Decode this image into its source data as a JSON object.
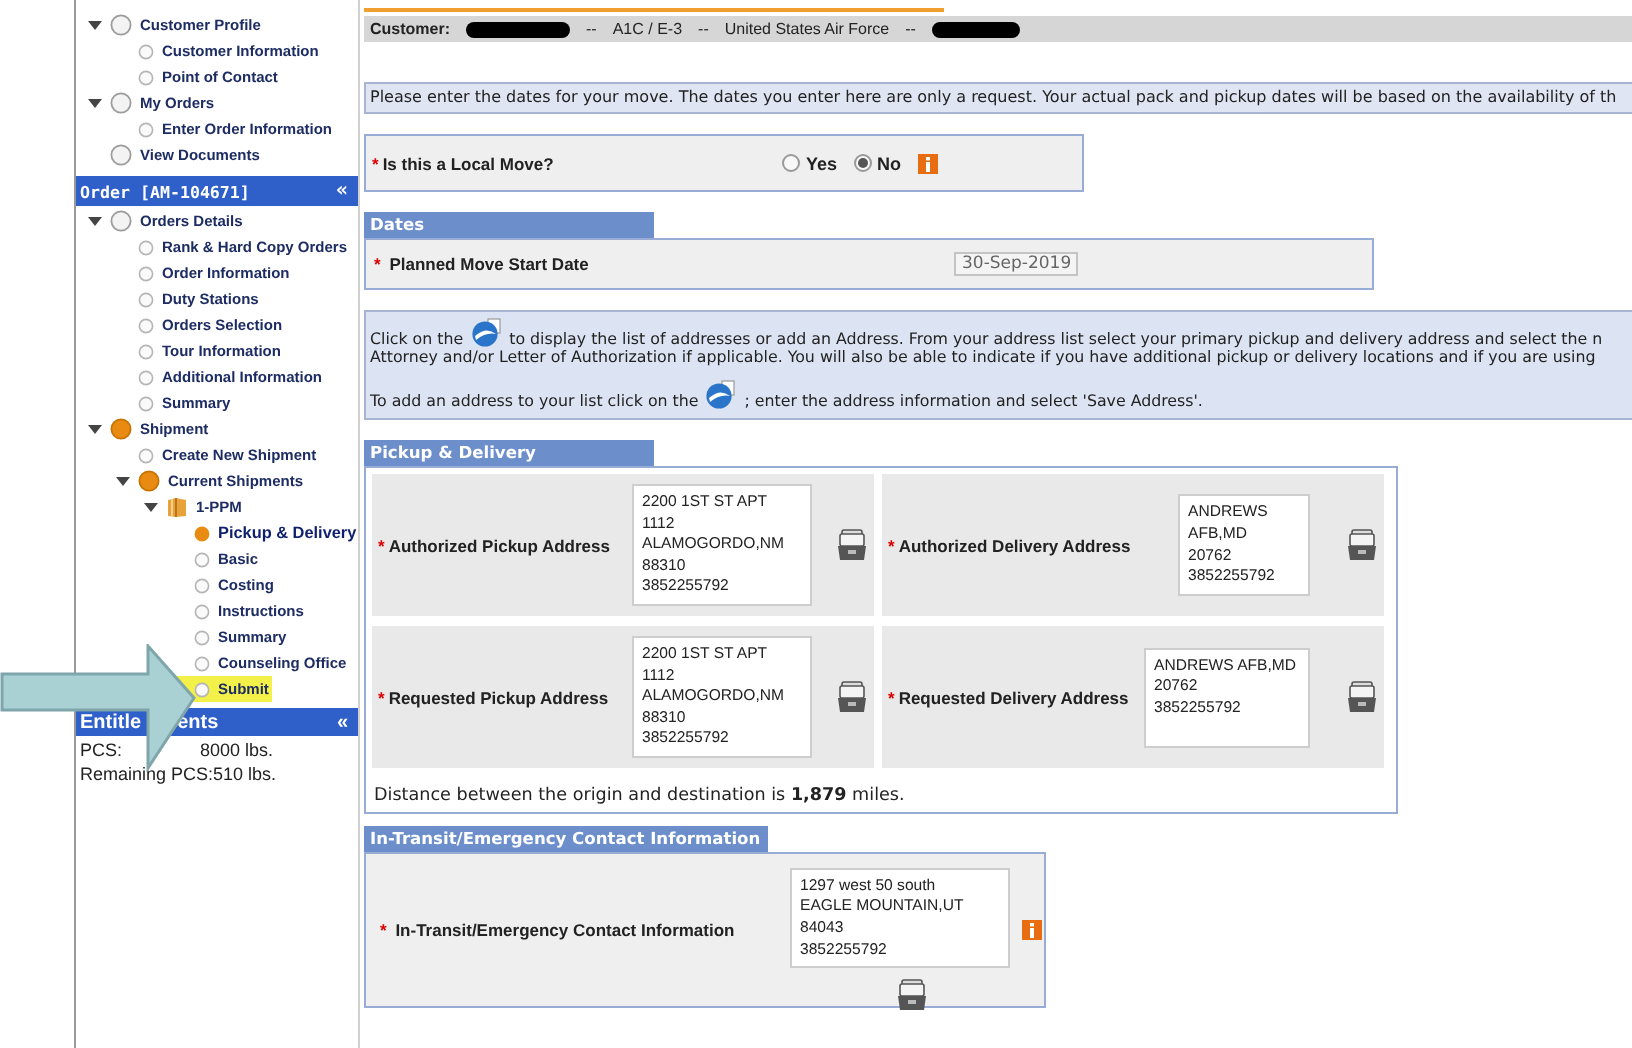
{
  "sidebar": {
    "tree": [
      {
        "label": "Customer Profile",
        "kind": "group",
        "active": false,
        "selected": false,
        "highlighted": false,
        "expanded": true,
        "children": [
          {
            "label": "Customer Information",
            "kind": "page",
            "active": false,
            "selected": false,
            "highlighted": false
          },
          {
            "label": "Point of Contact",
            "kind": "page",
            "active": false,
            "selected": false,
            "highlighted": false
          }
        ]
      },
      {
        "label": "My Orders",
        "kind": "group",
        "active": false,
        "selected": false,
        "highlighted": false,
        "expanded": true,
        "children": [
          {
            "label": "Enter Order Information",
            "kind": "page",
            "active": false,
            "selected": false,
            "highlighted": false
          }
        ]
      },
      {
        "label": "View Documents",
        "kind": "group",
        "active": false,
        "selected": false,
        "highlighted": false
      }
    ],
    "order_panel": {
      "title": "Order [AM-104671]",
      "collapse": "«",
      "tree": [
        {
          "label": "Orders Details",
          "kind": "group",
          "active": false,
          "selected": false,
          "highlighted": false,
          "expanded": true,
          "children": [
            {
              "label": "Rank & Hard Copy Orders",
              "kind": "page",
              "active": false,
              "selected": false,
              "highlighted": false
            },
            {
              "label": "Order Information",
              "kind": "page",
              "active": false,
              "selected": false,
              "highlighted": false
            },
            {
              "label": "Duty Stations",
              "kind": "page",
              "active": false,
              "selected": false,
              "highlighted": false
            },
            {
              "label": "Orders Selection",
              "kind": "page",
              "active": false,
              "selected": false,
              "highlighted": false
            },
            {
              "label": "Tour Information",
              "kind": "page",
              "active": false,
              "selected": false,
              "highlighted": false
            },
            {
              "label": "Additional Information",
              "kind": "page",
              "active": false,
              "selected": false,
              "highlighted": false
            },
            {
              "label": "Summary",
              "kind": "page",
              "active": false,
              "selected": false,
              "highlighted": false
            }
          ]
        },
        {
          "label": "Shipment",
          "kind": "group",
          "active": true,
          "selected": false,
          "highlighted": false,
          "expanded": true,
          "children": [
            {
              "label": "Create New Shipment",
              "kind": "page",
              "active": false,
              "selected": false,
              "highlighted": false
            },
            {
              "label": "Current Shipments",
              "kind": "group",
              "active": true,
              "selected": false,
              "highlighted": false,
              "expanded": true,
              "children": [
                {
                  "label": "1-PPM",
                  "kind": "shipment",
                  "active": true,
                  "selected": false,
                  "highlighted": false,
                  "expanded": true,
                  "children": [
                    {
                      "label": "Pickup & Delivery",
                      "kind": "page",
                      "active": true,
                      "selected": true,
                      "highlighted": false
                    },
                    {
                      "label": "Basic",
                      "kind": "page",
                      "active": false,
                      "selected": false,
                      "highlighted": false
                    },
                    {
                      "label": "Costing",
                      "kind": "page",
                      "active": false,
                      "selected": false,
                      "highlighted": false
                    },
                    {
                      "label": "Instructions",
                      "kind": "page",
                      "active": false,
                      "selected": false,
                      "highlighted": false
                    },
                    {
                      "label": "Summary",
                      "kind": "page",
                      "active": false,
                      "selected": false,
                      "highlighted": false
                    },
                    {
                      "label": "Counseling Office",
                      "kind": "page",
                      "active": false,
                      "selected": false,
                      "highlighted": false
                    },
                    {
                      "label": "Submit",
                      "kind": "page",
                      "active": false,
                      "selected": false,
                      "highlighted": true
                    }
                  ]
                }
              ]
            }
          ]
        }
      ]
    },
    "entitlements_panel": {
      "title_parts": [
        "Entitle",
        "ents"
      ],
      "collapse": "«",
      "rows": [
        {
          "label": "PCS:",
          "value": "8000 lbs."
        }
      ],
      "remaining": "Remaining PCS:510 lbs."
    }
  },
  "customer_bar": {
    "label": "Customer:",
    "items": [
      {
        "kind": "redacted"
      },
      {
        "kind": "text",
        "text": "--"
      },
      {
        "kind": "text",
        "text": "A1C / E-3"
      },
      {
        "kind": "text",
        "text": "--"
      },
      {
        "kind": "text",
        "text": "United States Air Force"
      },
      {
        "kind": "text",
        "text": "--"
      },
      {
        "kind": "redacted"
      }
    ]
  },
  "notice": "Please enter the dates for your move. The dates you enter here are only a request. Your actual pack and pickup dates will be based on the availability of th",
  "local_move": {
    "required_mark": "*",
    "label": "Is this a Local Move?",
    "options": [
      {
        "label": "Yes",
        "selected": false
      },
      {
        "label": "No",
        "selected": true
      }
    ]
  },
  "dates": {
    "title": "Dates",
    "fields": [
      {
        "required_mark": "*",
        "label": "Planned Move Start Date",
        "value": "30-Sep-2019",
        "disabled": true
      }
    ]
  },
  "address_help": {
    "line_1_before": "Click on the",
    "line_1_after": "to display the list of addresses or add an Address. From your address list select your primary pickup and delivery address and select the n",
    "line_2": "Attorney and/or Letter of Authorization if applicable. You will also be able to indicate if you have additional pickup or delivery locations and if you are using",
    "line_3_before": "To add an address to your list click on the",
    "line_3_after": "; enter the address information and select 'Save Address'."
  },
  "pickup_delivery": {
    "title": "Pickup & Delivery",
    "addresses": [
      {
        "required_mark": "*",
        "label": "Authorized Pickup Address",
        "value": "2200 1ST ST APT\n1112\nALAMOGORDO,NM\n88310\n3852255792"
      },
      {
        "required_mark": "*",
        "label": "Authorized Delivery Address",
        "value": "ANDREWS AFB,MD\n20762\n3852255792"
      },
      {
        "required_mark": "*",
        "label": "Requested Pickup Address",
        "value": "2200 1ST ST APT\n1112\nALAMOGORDO,NM\n88310\n3852255792"
      },
      {
        "required_mark": "*",
        "label": "Requested Delivery Address",
        "value": "ANDREWS AFB,MD\n20762\n3852255792"
      }
    ],
    "distance": "Distance between the origin and destination is **1,879** miles."
  },
  "in_transit": {
    "title": "In-Transit/Emergency Contact Information",
    "required_mark": "*",
    "label": "In-Transit/Emergency Contact Information",
    "value": "1297 west 50 south\nEAGLE MOUNTAIN,UT\n84043\n3852255792"
  }
}
